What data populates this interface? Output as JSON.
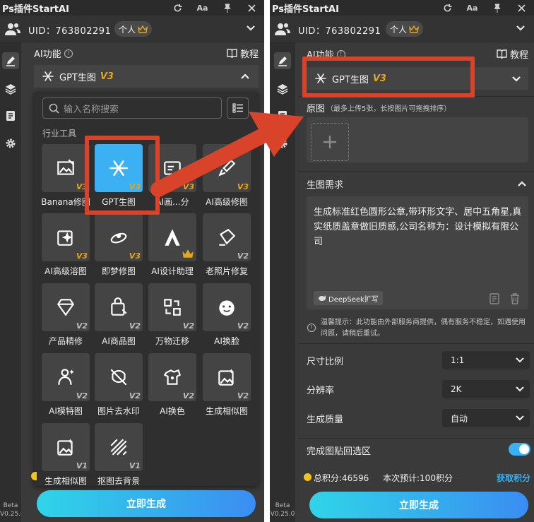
{
  "app_title": "Ps插件StartAI",
  "titlebar": {
    "font_btn": "Aa"
  },
  "user": {
    "uid": "UID：763802291",
    "plan": "个人"
  },
  "beta": {
    "tag": "Beta",
    "version": "V0.25.0"
  },
  "ai_section": {
    "title": "AI功能",
    "tutorial": "教程"
  },
  "current_tool": {
    "name": "GPT生图",
    "version": "V3"
  },
  "dropdown": {
    "search_placeholder": "输入名称搜索",
    "category": "行业工具",
    "tools": [
      {
        "name": "Banana修图",
        "badge": "V3",
        "icon": "image-edit-icon"
      },
      {
        "name": "GPT生图",
        "badge": "V3",
        "icon": "gpt-knot-icon",
        "selected": true
      },
      {
        "name": "AI画...分",
        "badge": "V3",
        "icon": "layers-icon"
      },
      {
        "name": "AI高级修图",
        "badge": "V3",
        "icon": "brush-icon"
      },
      {
        "name": "AI高级溶图",
        "badge": "V3",
        "icon": "sparkle-image-icon"
      },
      {
        "name": "即梦修图",
        "badge": "V3",
        "icon": "dream-icon"
      },
      {
        "name": "AI设计助理",
        "badge": "crown",
        "icon": "design-assistant-icon"
      },
      {
        "name": "老照片修复",
        "badge": "V2",
        "icon": "photo-repair-icon"
      },
      {
        "name": "产品精修",
        "badge": "V2",
        "icon": "diamond-icon"
      },
      {
        "name": "AI商品图",
        "badge": "V2",
        "icon": "shopping-bag-icon"
      },
      {
        "name": "万物迁移",
        "badge": "V2",
        "icon": "transfer-icon"
      },
      {
        "name": "AI换脸",
        "badge": "V2",
        "icon": "face-icon"
      },
      {
        "name": "AI模特图",
        "badge": "V2",
        "icon": "model-icon"
      },
      {
        "name": "图片去水印",
        "badge": "V2",
        "icon": "no-watermark-icon"
      },
      {
        "name": "AI换色",
        "badge": "V2",
        "icon": "palette-icon"
      },
      {
        "name": "生成相似图",
        "badge": "V2",
        "icon": "similar-image-icon"
      },
      {
        "name": "生成相似图",
        "badge": "V1",
        "icon": "similar-image-icon"
      },
      {
        "name": "抠图去背景",
        "badge": "V1",
        "icon": "stripes-icon"
      }
    ]
  },
  "generate_label": "立即生成",
  "right_panel": {
    "original": {
      "title": "原图",
      "hint": "（最多上传5张，长按图片可拖拽排序）"
    },
    "requirement": {
      "title": "生图需求",
      "text": "生成标准红色圆形公章,带环形文字、居中五角星,真实纸质盖章做旧质感,公司名称为：设计模拟有限公司",
      "deepseek": "DeepSeek扩写"
    },
    "notice": "温馨提示：此功能由外部服务商提供，偶有服务不稳定，如遇使用问题，请稍后重试。",
    "settings": [
      {
        "label": "尺寸比例",
        "value": "1:1"
      },
      {
        "label": "分辨率",
        "value": "2K"
      },
      {
        "label": "生成质量",
        "value": "自动"
      }
    ],
    "paste_back": {
      "label": "完成图贴回选区",
      "enabled": true
    },
    "points": {
      "total": "总积分:46596",
      "estimate": "本次预计:100积分",
      "get": "获取积分"
    }
  },
  "colors": {
    "accent": "#3bb0f2",
    "highlight": "#d9432a",
    "gold": "#e5a51c"
  }
}
